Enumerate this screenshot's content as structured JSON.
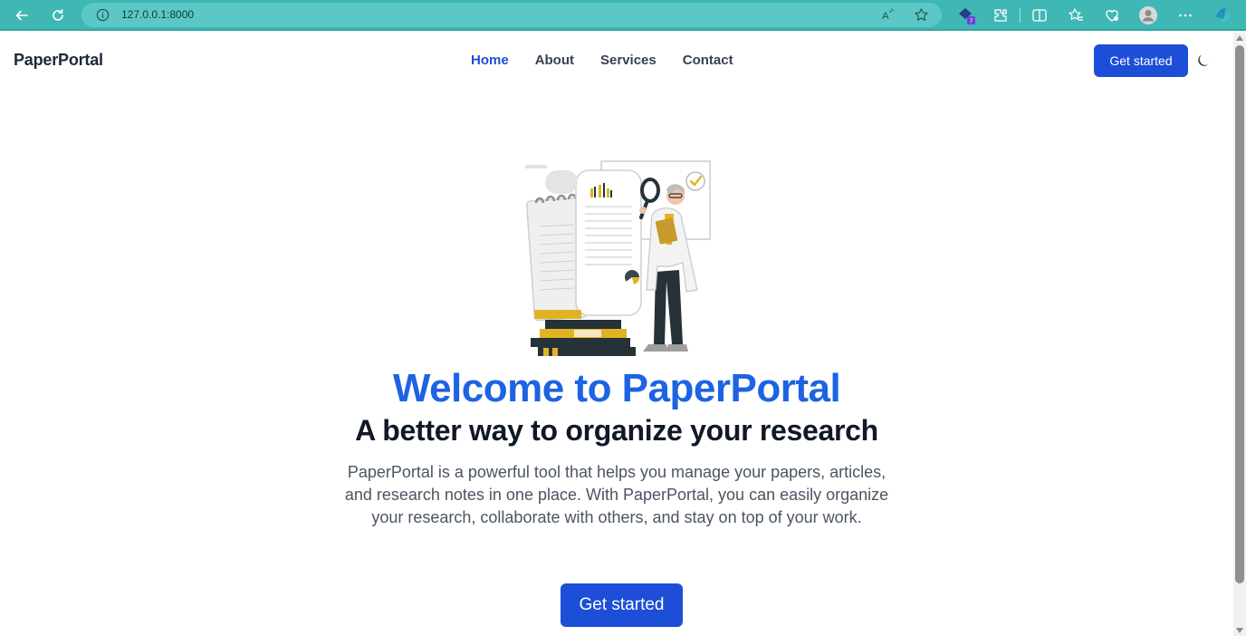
{
  "browser": {
    "url": "127.0.0.1:8000",
    "icons": [
      "back-arrow-icon",
      "reload-icon",
      "info-icon",
      "read-aloud-icon",
      "favorite-star-icon",
      "extension-badge-icon",
      "puzzle-icon",
      "split-screen-icon",
      "favorites-icon",
      "browser-essentials-icon",
      "profile-icon",
      "more-icon",
      "copilot-icon"
    ],
    "extension_badge_count": "7",
    "theme_color": "#3fb7b4"
  },
  "header": {
    "brand": "PaperPortal",
    "nav": [
      {
        "label": "Home",
        "active": true
      },
      {
        "label": "About",
        "active": false
      },
      {
        "label": "Services",
        "active": false
      },
      {
        "label": "Contact",
        "active": false
      }
    ],
    "cta_label": "Get started",
    "theme_toggle_icon": "moon-icon"
  },
  "hero": {
    "illustration": "researcher-with-magnifier-illustration",
    "title": "Welcome to PaperPortal",
    "subtitle": "A better way to organize your research",
    "description": "PaperPortal is a powerful tool that helps you manage your papers, articles, and research notes in one place. With PaperPortal, you can easily organize your research, collaborate with others, and stay on top of your work.",
    "cta_label": "Get started"
  },
  "colors": {
    "primary": "#1d4ed8",
    "title_blue": "#1d63e3",
    "text_dark": "#111827",
    "text_muted": "#4b5563"
  }
}
